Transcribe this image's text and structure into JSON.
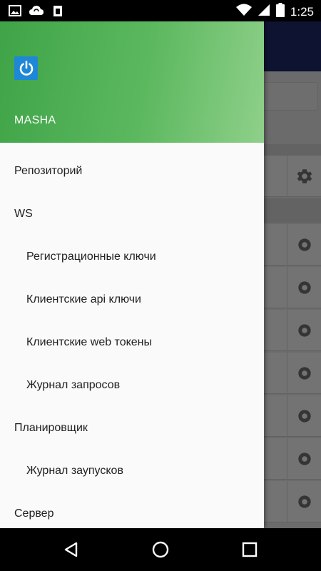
{
  "status_bar": {
    "time": "1:25",
    "left_icons": [
      "image-icon",
      "cloud-sync-icon",
      "clipboard-icon"
    ],
    "right_icons": [
      "wifi-icon",
      "signal-icon",
      "battery-icon"
    ]
  },
  "drawer": {
    "logo_icon": "power-icon",
    "user_name": "MASHA",
    "items": [
      {
        "label": "Репозиторий",
        "level": 0
      },
      {
        "label": "WS",
        "level": 0
      },
      {
        "label": "Регистрационные ключи",
        "level": 1
      },
      {
        "label": "Клиентские api ключи",
        "level": 1
      },
      {
        "label": "Клиентские web токены",
        "level": 1
      },
      {
        "label": "Журнал запросов",
        "level": 1
      },
      {
        "label": "Планировщик",
        "level": 0
      },
      {
        "label": "Журнал заупусков",
        "level": 1
      },
      {
        "label": "Сервер",
        "level": 0
      }
    ]
  },
  "nav_bar": {
    "icons": [
      "back-icon",
      "home-icon",
      "recents-icon"
    ]
  },
  "colors": {
    "header_start": "#3fa447",
    "header_end": "#8fd08a",
    "toolbar": "#1d2a6e",
    "logo": "#1e88d6"
  }
}
